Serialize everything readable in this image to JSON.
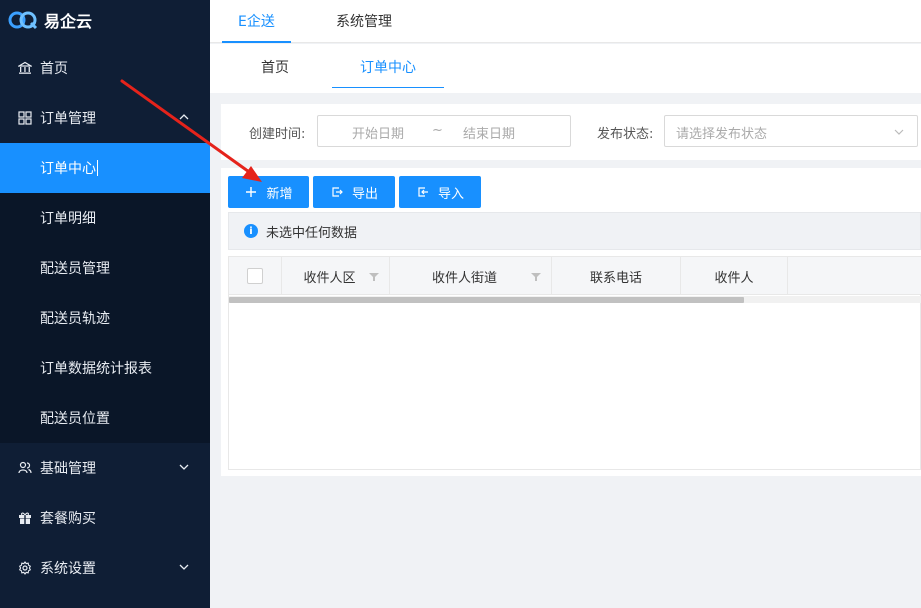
{
  "app": {
    "name": "易企云"
  },
  "sidebar": {
    "items": [
      {
        "label": "首页",
        "icon": "bank-icon"
      },
      {
        "label": "订单管理",
        "icon": "grid-icon",
        "expanded": true,
        "children": [
          {
            "label": "订单中心",
            "active": true
          },
          {
            "label": "订单明细"
          },
          {
            "label": "配送员管理"
          },
          {
            "label": "配送员轨迹"
          },
          {
            "label": "订单数据统计报表"
          },
          {
            "label": "配送员位置"
          }
        ]
      },
      {
        "label": "基础管理",
        "icon": "user-group-icon"
      },
      {
        "label": "套餐购买",
        "icon": "gift-icon"
      },
      {
        "label": "系统设置",
        "icon": "gear-icon"
      }
    ]
  },
  "topnav": {
    "tabs": [
      {
        "label": "E企送",
        "active": true
      },
      {
        "label": "系统管理"
      }
    ]
  },
  "pagetabs": {
    "tabs": [
      {
        "label": "首页"
      },
      {
        "label": "订单中心",
        "active": true
      }
    ]
  },
  "filter": {
    "created_label": "创建时间:",
    "start_placeholder": "开始日期",
    "separator": "~",
    "end_placeholder": "结束日期",
    "status_label": "发布状态:",
    "status_placeholder": "请选择发布状态"
  },
  "toolbar": {
    "add_label": "新增",
    "export_label": "导出",
    "import_label": "导入"
  },
  "info": {
    "text": "未选中任何数据"
  },
  "table": {
    "columns": [
      {
        "label": "收件人区",
        "filter": true
      },
      {
        "label": "收件人街道",
        "filter": true
      },
      {
        "label": "联系电话"
      },
      {
        "label": "收件人"
      }
    ]
  },
  "colors": {
    "accent": "#1890ff",
    "sidebar": "#0f1e35",
    "submenu": "#0a1628",
    "annotation": "#e5231b"
  }
}
